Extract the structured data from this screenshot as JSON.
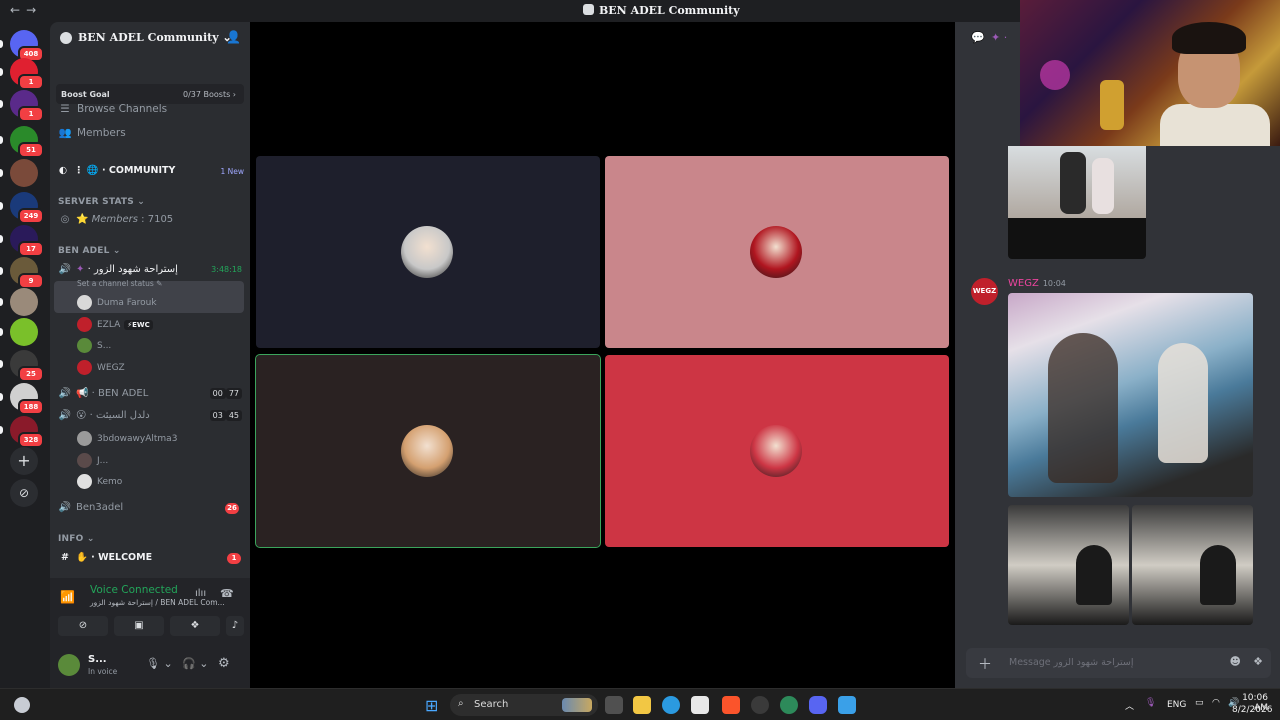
{
  "window": {
    "title": "BEN ADEL Community",
    "nav_back": "←",
    "nav_forward": "→"
  },
  "rail": {
    "servers": [
      {
        "badge": "408",
        "color": "#5865f2"
      },
      {
        "badge": "1",
        "color": "#e02030"
      },
      {
        "badge": "1",
        "color": "#5a2a8a"
      },
      {
        "badge": "51",
        "color": "#2a8a2a"
      },
      {
        "badge": "",
        "color": "#7a4a3a"
      },
      {
        "badge": "249",
        "color": "#1a3a7a"
      },
      {
        "badge": "17",
        "color": "#2a1a5a"
      },
      {
        "badge": "9",
        "color": "#6a5a3a"
      },
      {
        "badge": "",
        "color": "#9a8a7a"
      },
      {
        "badge": "",
        "color": "#7ac02a"
      },
      {
        "badge": "25",
        "color": "#3a3a3a"
      },
      {
        "badge": "188",
        "color": "#d0d0d0"
      },
      {
        "badge": "328",
        "color": "#8a1a2a"
      }
    ],
    "add_server": "+",
    "explore": "⊘"
  },
  "sidebar": {
    "guild_name": "BEN ADEL Community",
    "boost_goal_label": "Boost Goal",
    "boost_goal_value": "0/37 Boosts",
    "browse_channels": "Browse Channels",
    "members": "Members",
    "community_channel": "COMMUNITY",
    "community_new": "1 New",
    "cat_server_stats": "SERVER STATS",
    "members_stat_label": "Members",
    "members_stat_value": "7105",
    "cat_ben_adel": "BEN ADEL",
    "active_voice_channel": "إستراحة شهود الزور",
    "active_voice_timer": "3:48:18",
    "set_status": "Set a channel status",
    "voice_users_1": [
      {
        "name": "Duma Farouk",
        "color": "#d8d8d8"
      },
      {
        "name": "EZLA",
        "tag": "EWC",
        "color": "#c0202b"
      },
      {
        "name": "S...",
        "color": "#5a8a3a"
      },
      {
        "name": "WEGZ",
        "color": "#c0202b"
      }
    ],
    "ben_adel_channel": "BEN ADEL",
    "ben_adel_counts": [
      "00",
      "77"
    ],
    "second_voice_channel": "دلدل السيئت",
    "second_voice_counts": [
      "03",
      "45"
    ],
    "voice_users_2": [
      {
        "name": "3bdowawyAltma3",
        "color": "#9a9a9a"
      },
      {
        "name": "J...",
        "color": "#5a4a4a"
      },
      {
        "name": "Kemo",
        "color": "#e0e0e0"
      }
    ],
    "ben3adel_channel": "Ben3adel",
    "ben3adel_badge": "26",
    "cat_info": "INFO",
    "welcome_channel": "WELCOME",
    "welcome_badge": "1"
  },
  "voice_panel": {
    "status": "Voice Connected",
    "location": "إستراحة شهود الزور / BEN ADEL Com...",
    "user_name": "S...",
    "user_status": "In voice"
  },
  "video_tiles": [
    {
      "bg": "#1e1f2c",
      "avatar": "#c8c8c8",
      "speaking": false
    },
    {
      "bg": "#c9868b",
      "avatar": "#b0151f",
      "speaking": false
    },
    {
      "bg": "#2a2222",
      "avatar": "#d4a070",
      "speaking": true
    },
    {
      "bg": "#cd3544",
      "avatar": "#cd3544",
      "speaking": false
    }
  ],
  "chat": {
    "message_author": "WEGZ",
    "message_time": "10:04",
    "composer_placeholder": "Message  إستراحة شهود الزور",
    "avatar_text": "WEGZ"
  },
  "taskbar": {
    "search_label": "Search",
    "language": "ENG",
    "time": "10:06 AM",
    "date": "8/2/2026"
  }
}
